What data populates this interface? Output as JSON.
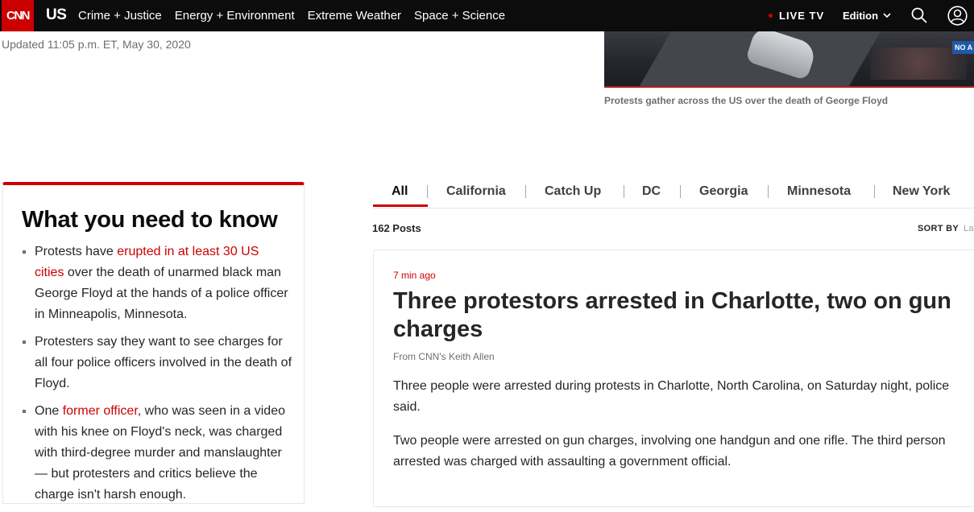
{
  "nav": {
    "logo": "CNN",
    "section": "US",
    "links": [
      "Crime + Justice",
      "Energy + Environment",
      "Extreme Weather",
      "Space + Science"
    ],
    "live_tv": "LIVE TV",
    "edition": "Edition",
    "icons": {
      "search": "search-icon",
      "account": "account-icon",
      "chevron": "chevron-down-icon"
    },
    "colors": {
      "bar": "#0c0c0c",
      "logo": "#cc0000"
    }
  },
  "header": {
    "updated": "Updated 11:05 p.m. ET, May 30, 2020",
    "hero_caption": "Protests gather across the US over the death of George Floyd",
    "hero_bug": "NO A"
  },
  "wyntk": {
    "title": "What you need to know",
    "bullets": [
      {
        "before": "Protests have ",
        "link": "erupted in at least 30 US cities",
        "after": " over the death of unarmed black man George Floyd at the hands of a police officer in Minneapolis, Minnesota."
      },
      {
        "before": "Protesters say they want to see charges for all four police officers involved in the death of Floyd.",
        "link": "",
        "after": ""
      },
      {
        "before": "One ",
        "link": "former officer",
        "after": ", who was seen in a video with his knee on Floyd's neck, was charged with third-degree murder and manslaughter — but protesters and critics believe the charge isn't harsh enough."
      }
    ]
  },
  "tabs": [
    "All",
    "California",
    "Catch Up",
    "DC",
    "Georgia",
    "Minnesota",
    "New York"
  ],
  "feed": {
    "post_count": "162 Posts",
    "sort_label": "SORT BY",
    "sort_value": "La"
  },
  "post": {
    "time": "7 min ago",
    "headline": "Three protestors arrested in Charlotte, two on gun charges",
    "byline": "From CNN's Keith Allen",
    "paragraphs": [
      "Three people were arrested during protests in Charlotte, North Carolina, on Saturday night, police said.",
      "Two people were arrested on gun charges, involving one handgun and one rifle. The third person arrested was charged with assaulting a government official."
    ]
  }
}
